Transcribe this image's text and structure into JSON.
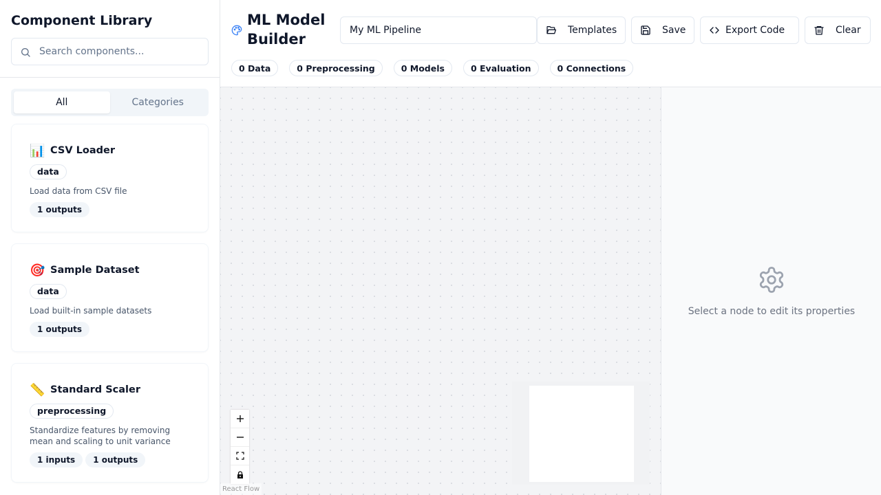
{
  "sidebar": {
    "title": "Component Library",
    "search_placeholder": "Search components...",
    "tabs": [
      {
        "label": "All",
        "active": true
      },
      {
        "label": "Categories",
        "active": false
      }
    ],
    "components": [
      {
        "icon": "📊",
        "icon_name": "bar-chart-icon",
        "name": "CSV Loader",
        "category": "data",
        "description": "Load data from CSV file",
        "ports": [
          "1 outputs"
        ]
      },
      {
        "icon": "🎯",
        "icon_name": "target-icon",
        "name": "Sample Dataset",
        "category": "data",
        "description": "Load built-in sample datasets",
        "ports": [
          "1 outputs"
        ]
      },
      {
        "icon": "📏",
        "icon_name": "ruler-icon",
        "name": "Standard Scaler",
        "category": "preprocessing",
        "description": "Standardize features by removing mean and scaling to unit variance",
        "ports": [
          "1 inputs",
          "1 outputs"
        ]
      }
    ]
  },
  "header": {
    "title": "ML Model Builder",
    "pipeline_name": "My ML Pipeline",
    "buttons": {
      "templates": "Templates",
      "save": "Save",
      "export": "Export Code",
      "clear": "Clear"
    },
    "stats": [
      {
        "label": "0 Data"
      },
      {
        "label": "0 Preprocessing"
      },
      {
        "label": "0 Models"
      },
      {
        "label": "0 Evaluation"
      },
      {
        "label": "0 Connections"
      }
    ]
  },
  "canvas": {
    "attribution": "React Flow",
    "controls": [
      "zoom-in",
      "zoom-out",
      "fit-view",
      "lock"
    ]
  },
  "properties": {
    "empty_text": "Select a node to edit its properties"
  },
  "colors": {
    "accent": "#3b82f6",
    "canvas_bg": "#f3f4f6",
    "panel_bg": "#f9fafb"
  }
}
